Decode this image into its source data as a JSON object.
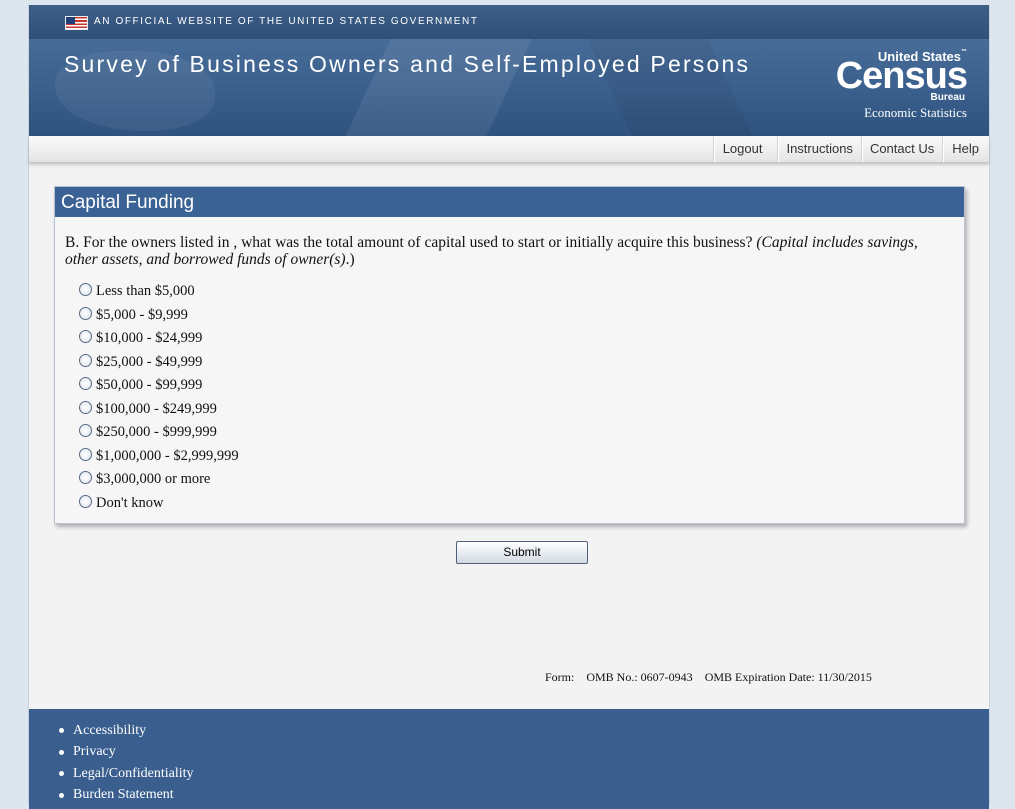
{
  "gov_banner": {
    "text": "AN OFFICIAL WEBSITE OF THE UNITED STATES GOVERNMENT"
  },
  "header": {
    "title": "Survey of Business Owners and Self-Employed Persons",
    "logo": {
      "line1": "United States",
      "tm": "™",
      "line2": "Census",
      "line3": "Bureau",
      "line4": "Economic Statistics"
    }
  },
  "nav": {
    "logout": "Logout",
    "instructions": "Instructions",
    "contact": "Contact Us",
    "help": "Help"
  },
  "panel": {
    "title": "Capital Funding",
    "question_main": "B. For the owners listed in , what was the total amount of capital used to start or initially acquire this business? ",
    "question_note": "(Capital includes savings, other assets, and borrowed funds of owner(s)",
    "question_end": ".)",
    "options": [
      "Less than $5,000",
      "$5,000 - $9,999",
      "$10,000 - $24,999",
      "$25,000 - $49,999",
      "$50,000 - $99,999",
      "$100,000 - $249,999",
      "$250,000 - $999,999",
      "$1,000,000 - $2,999,999",
      "$3,000,000 or more",
      "Don't know"
    ]
  },
  "submit_label": "Submit",
  "omb": {
    "form": "Form:",
    "omb_no": "OMB No.: 0607-0943",
    "expiration": "OMB Expiration Date: 11/30/2015"
  },
  "footer": {
    "links": [
      "Accessibility",
      "Privacy",
      "Legal/Confidentiality",
      "Burden Statement"
    ]
  }
}
